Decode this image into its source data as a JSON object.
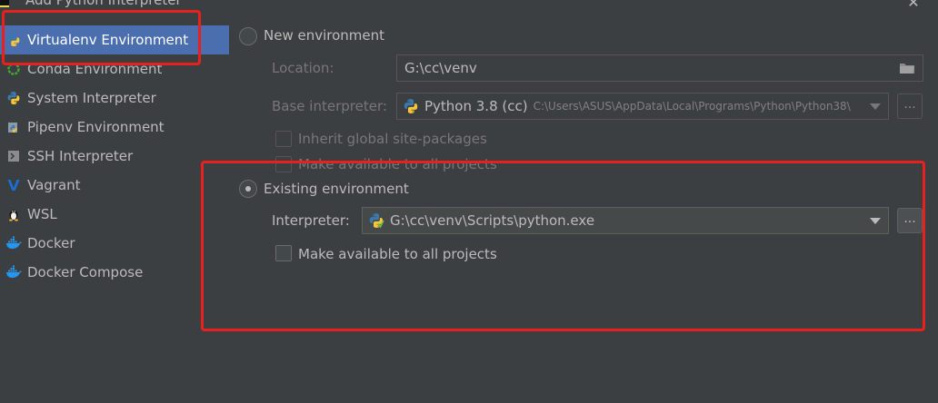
{
  "window": {
    "title": "Add Python Interpreter"
  },
  "sidebar": {
    "items": [
      {
        "label": "Virtualenv Environment",
        "icon": "python-icon"
      },
      {
        "label": "Conda Environment",
        "icon": "conda-icon"
      },
      {
        "label": "System Interpreter",
        "icon": "python-icon"
      },
      {
        "label": "Pipenv Environment",
        "icon": "pipenv-icon"
      },
      {
        "label": "SSH Interpreter",
        "icon": "terminal-icon"
      },
      {
        "label": "Vagrant",
        "icon": "vagrant-icon"
      },
      {
        "label": "WSL",
        "icon": "linux-penguin-icon"
      },
      {
        "label": "Docker",
        "icon": "docker-icon"
      },
      {
        "label": "Docker Compose",
        "icon": "docker-icon"
      }
    ],
    "selected": "Virtualenv Environment"
  },
  "new_env": {
    "label": "New environment",
    "location_label": "Location:",
    "location_value": "G:\\cc\\venv",
    "base_label": "Base interpreter:",
    "base_name": "Python 3.8 (cc)",
    "base_path": "C:\\Users\\ASUS\\AppData\\Local\\Programs\\Python\\Python38\\",
    "inherit_label": "Inherit global site-packages",
    "make_available_label": "Make available to all projects",
    "browse_label": "..."
  },
  "existing_env": {
    "label": "Existing environment",
    "interpreter_label": "Interpreter:",
    "interpreter_value": "G:\\cc\\venv\\Scripts\\python.exe",
    "make_available_label": "Make available to all projects",
    "browse_label": "..."
  },
  "colors": {
    "background": "#3c3f41",
    "selection": "#4b6eaf",
    "highlight_box": "#e8201e"
  }
}
